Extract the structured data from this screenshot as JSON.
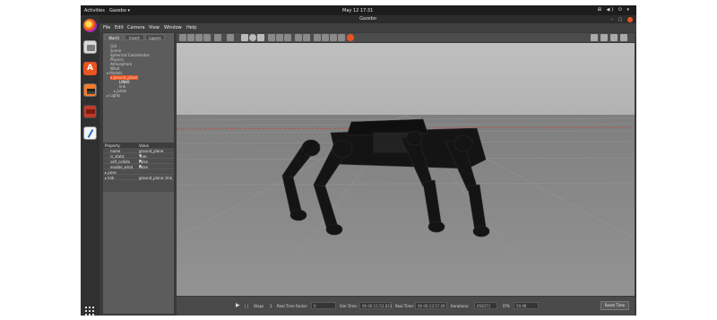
{
  "topbar": {
    "activities": "Activities",
    "app_name": "Gazebo ▾",
    "clock": "May 12  17:31",
    "tray": "⊞ ◀) ⏻ ▾"
  },
  "dock": {
    "items": [
      "firefox-icon",
      "files-icon",
      "software-store-icon",
      "gazebo-icon",
      "terminal-icon",
      "text-editor-icon"
    ],
    "show_apps_icon": "show-apps-icon"
  },
  "window": {
    "title": "Gazebo",
    "controls": "–  ▢",
    "close_color": "#e95420"
  },
  "menu": [
    "File",
    "Edit",
    "Camera",
    "View",
    "Window",
    "Help"
  ],
  "left_panel": {
    "tabs": [
      "World",
      "Insert",
      "Layers"
    ],
    "active_tab": "World",
    "tree": [
      "GUI",
      "Scene",
      "Spherical Coordinates",
      "Physics",
      "Atmosphere",
      "Wind",
      "▾ Models",
      "▾ ground_plane",
      "LINK0",
      "link",
      "▸ joints",
      "▸ Lights"
    ],
    "properties": {
      "headers": [
        "Property",
        "Value"
      ],
      "rows": [
        [
          "name",
          "ground_plane"
        ],
        [
          "is_static",
          "True"
        ],
        [
          "self_collide",
          "False"
        ],
        [
          "enable_wind",
          "False"
        ],
        [
          "▸ pose",
          ""
        ],
        [
          "▸ link",
          "ground_plane::link"
        ]
      ]
    }
  },
  "toolbar": {
    "accent": "#e95420"
  },
  "bottom": {
    "play_icon": "▶",
    "steps_label": "Steps",
    "steps_value": "1",
    "rtf_label": "Real Time Factor:",
    "rtf_value": "0",
    "sim_time_label": "Sim Time:",
    "sim_time_value": "00 00:11:53.833",
    "real_time_label": "Real Time:",
    "real_time_value": "00 00:13:57.09",
    "iterations_label": "Iterations:",
    "iterations_value": "658371",
    "fps_label": "FPS:",
    "fps_value": "59.98",
    "reset_label": "Reset Time"
  }
}
